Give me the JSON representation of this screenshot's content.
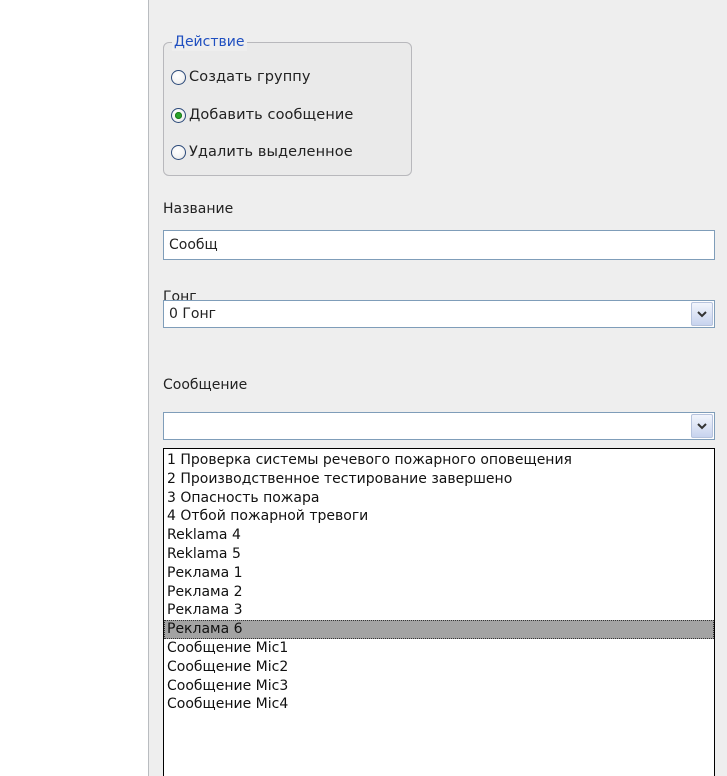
{
  "action_group": {
    "title": "Действие",
    "options": [
      {
        "label": "Создать группу",
        "selected": false
      },
      {
        "label": "Добавить сообщение",
        "selected": true
      },
      {
        "label": "Удалить выделенное",
        "selected": false
      }
    ]
  },
  "name_field": {
    "label": "Название",
    "value": "Сообщ"
  },
  "gong_field": {
    "label": "Гонг",
    "value": "0 Гонг"
  },
  "message_field": {
    "label": "Сообщение",
    "value": "",
    "selected_index": 9,
    "options": [
      "1 Проверка системы речевого пожарного оповещения",
      "2 Производственное тестирование завершено",
      "3 Опасность пожара",
      "4 Отбой пожарной тревоги",
      "Reklama 4",
      "Reklama 5",
      "Реклама 1",
      "Реклама 2",
      "Реклама 3",
      "Реклама 6",
      "Сообщение Mic1",
      "Сообщение Mic2",
      "Сообщение Mic3",
      "Сообщение Mic4"
    ]
  },
  "colors": {
    "group_title": "#1f4fc0",
    "radio_checked": "#2aa42a",
    "list_selection": "#a3a3a3",
    "field_border": "#7f9db9"
  }
}
